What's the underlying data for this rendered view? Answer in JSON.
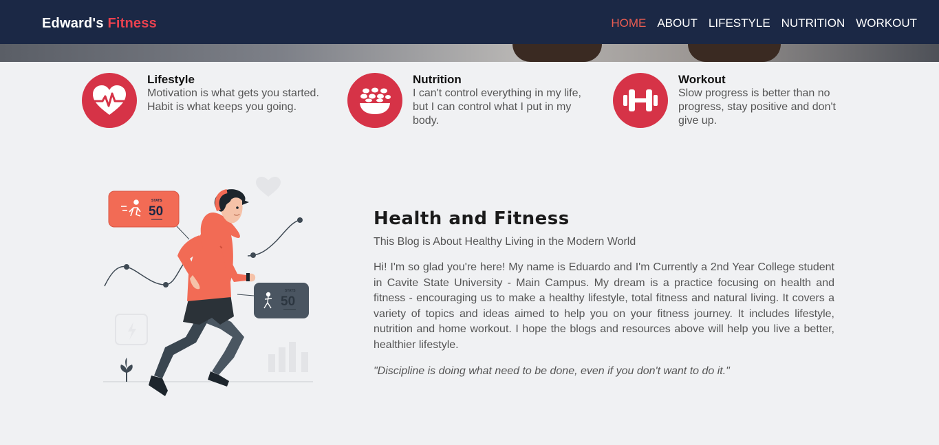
{
  "header": {
    "brand_main": "Edward's",
    "brand_accent": "Fitness",
    "nav": [
      "HOME",
      "ABOUT",
      "LIFESTYLE",
      "NUTRITION",
      "WORKOUT"
    ],
    "active_nav": "HOME"
  },
  "features": [
    {
      "title": "Lifestyle",
      "text": "Motivation is what gets you started. Habit is what keeps you going.",
      "icon": "heartbeat-icon"
    },
    {
      "title": "Nutrition",
      "text": "I can't control everything in my life, but I can control what I put in my body.",
      "icon": "food-bowl-icon"
    },
    {
      "title": "Workout",
      "text": "Slow progress is better than no progress, stay positive and don't give up.",
      "icon": "dumbbell-icon"
    }
  ],
  "illustration": {
    "card1_label": "STATS",
    "card1_value": "50",
    "card2_label": "STATS",
    "card2_value": "50"
  },
  "main": {
    "title": "Health and Fitness",
    "subtitle": "This Blog is About Healthy Living in the Modern World",
    "body": "Hi! I'm so glad you're here! My name is Eduardo and I'm Currently a 2nd Year College student in Cavite State University - Main Campus. My dream is a practice focusing on health and fitness - encouraging us to make a healthy lifestyle, total fitness and natural living. It covers a variety of topics and ideas aimed to help you on your fitness journey. It includes lifestyle, nutrition and home workout. I hope the blogs and resources above will help you live a better, healthier lifestyle.",
    "quote": "\"Discipline is doing what need to be done, even if you don't want to do it.\""
  },
  "colors": {
    "navbar": "#1b2845",
    "accent": "#e8414f",
    "icon_circle": "#d63347",
    "background": "#f0f1f3"
  }
}
